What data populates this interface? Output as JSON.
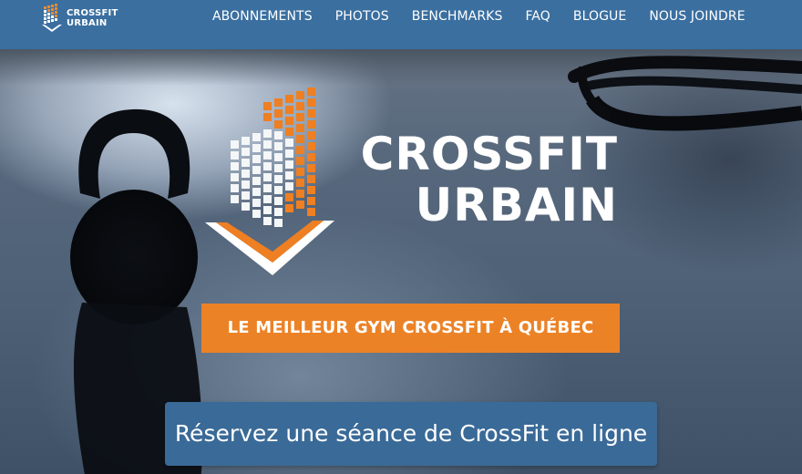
{
  "brand": {
    "line1": "CROSSFIT",
    "line2": "URBAIN",
    "icon": "building-logo-icon"
  },
  "nav": {
    "items": [
      {
        "label": "ABONNEMENTS"
      },
      {
        "label": "PHOTOS"
      },
      {
        "label": "BENCHMARKS"
      },
      {
        "label": "FAQ"
      },
      {
        "label": "BLOGUE"
      },
      {
        "label": "NOUS JOINDRE"
      }
    ]
  },
  "hero": {
    "title_line1": "CROSSFIT",
    "title_line2": "URBAIN",
    "logo_text": "CROSSFIT URBAIN",
    "tagline": "LE MEILLEUR GYM CROSSFIT À QUÉBEC",
    "cta": "Réservez une séance de CrossFit en ligne"
  },
  "colors": {
    "nav_bg": "#3a6fa0",
    "accent_orange": "#ec8226",
    "cta_bg": "#3a6a97",
    "text_light": "#ffffff"
  }
}
